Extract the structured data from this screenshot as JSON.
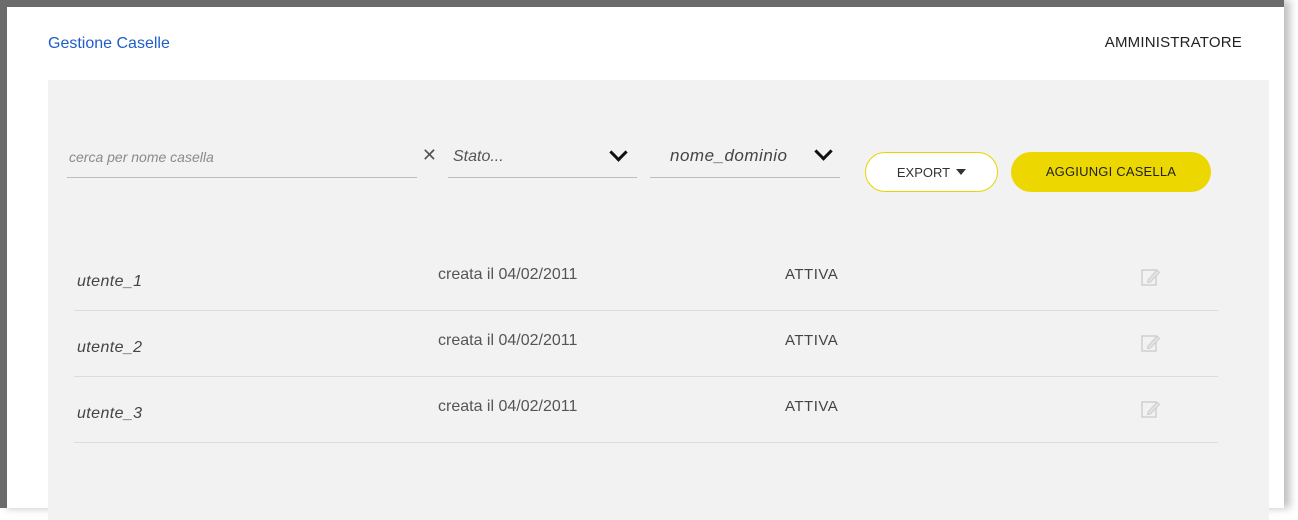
{
  "header": {
    "tab_label": "Gestione Caselle",
    "user_label": "AMMINISTRATORE"
  },
  "filters": {
    "search_placeholder": "cerca per nome casella",
    "clear_icon": "close-icon",
    "stato_label": "Stato...",
    "dominio_label": "nome_dominio"
  },
  "actions": {
    "export_label": "EXPORT",
    "add_label": "AGGIUNGI CASELLA",
    "accent_color": "#ecd800"
  },
  "rows": [
    {
      "name": "utente_1",
      "created": "creata il 04/02/2011",
      "status": "ATTIVA"
    },
    {
      "name": "utente_2",
      "created": "creata il 04/02/2011",
      "status": "ATTIVA"
    },
    {
      "name": "utente_3",
      "created": "creata il 04/02/2011",
      "status": "ATTIVA"
    }
  ]
}
